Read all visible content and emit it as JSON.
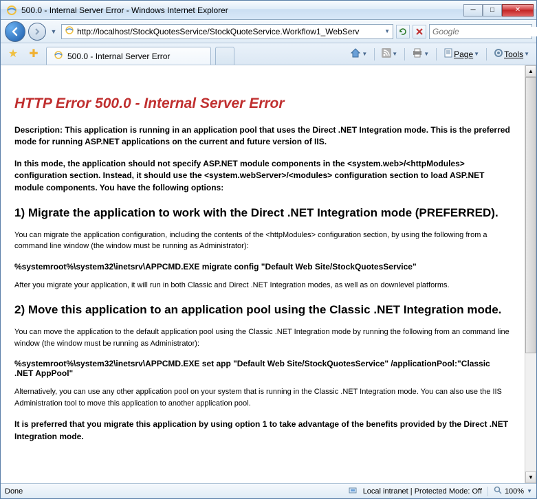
{
  "window": {
    "title": "500.0 - Internal Server Error - Windows Internet Explorer"
  },
  "address": {
    "url": "http://localhost/StockQuotesService/StockQuoteService.Workflow1_WebServ"
  },
  "search": {
    "placeholder": "Google"
  },
  "tab": {
    "title": "500.0 - Internal Server Error"
  },
  "toolbar": {
    "page": "Page",
    "tools": "Tools"
  },
  "error": {
    "title": "HTTP Error 500.0 - Internal Server Error",
    "description_label": "Description:",
    "description": "This application is running in an application pool that uses the Direct .NET Integration mode. This is the preferred mode for running ASP.NET applications on the current and future version of IIS.",
    "description_para2": "In this mode, the application should not specify ASP.NET module components in the <system.web>/<httpModules> configuration section. Instead, it should use the <system.webServer>/<modules> configuration section to load ASP.NET module components. You have the following options:",
    "section1_title": "1) Migrate the application to work with the Direct .NET Integration mode (PREFERRED).",
    "section1_para1": "You can migrate the application configuration, including the contents of the <httpModules> configuration section, by using the following from a command line window (the window must be running as Administrator):",
    "section1_cmd": "%systemroot%\\system32\\inetsrv\\APPCMD.EXE migrate config \"Default Web Site/StockQuotesService\"",
    "section1_para2": "After you migrate your application, it will run in both Classic and Direct .NET Integration modes, as well as on downlevel platforms.",
    "section2_title": "2) Move this application to an application pool using the Classic .NET Integration mode.",
    "section2_para1": "You can move the application to the default application pool using the Classic .NET Integration mode by running the following from an command line window (the window must be running as Administrator):",
    "section2_cmd": "%systemroot%\\system32\\inetsrv\\APPCMD.EXE set app \"Default Web Site/StockQuotesService\" /applicationPool:\"Classic .NET AppPool\"",
    "section2_para2": "Alternatively, you can use any other application pool on your system that is running in the Classic .NET Integration mode. You can also use the IIS Administration tool to move this application to another application pool.",
    "final": "It is preferred that you migrate this application by using option 1 to take advantage of the benefits provided by the Direct .NET Integration mode."
  },
  "status": {
    "done": "Done",
    "zone": "Local intranet | Protected Mode: Off",
    "zoom": "100%"
  }
}
